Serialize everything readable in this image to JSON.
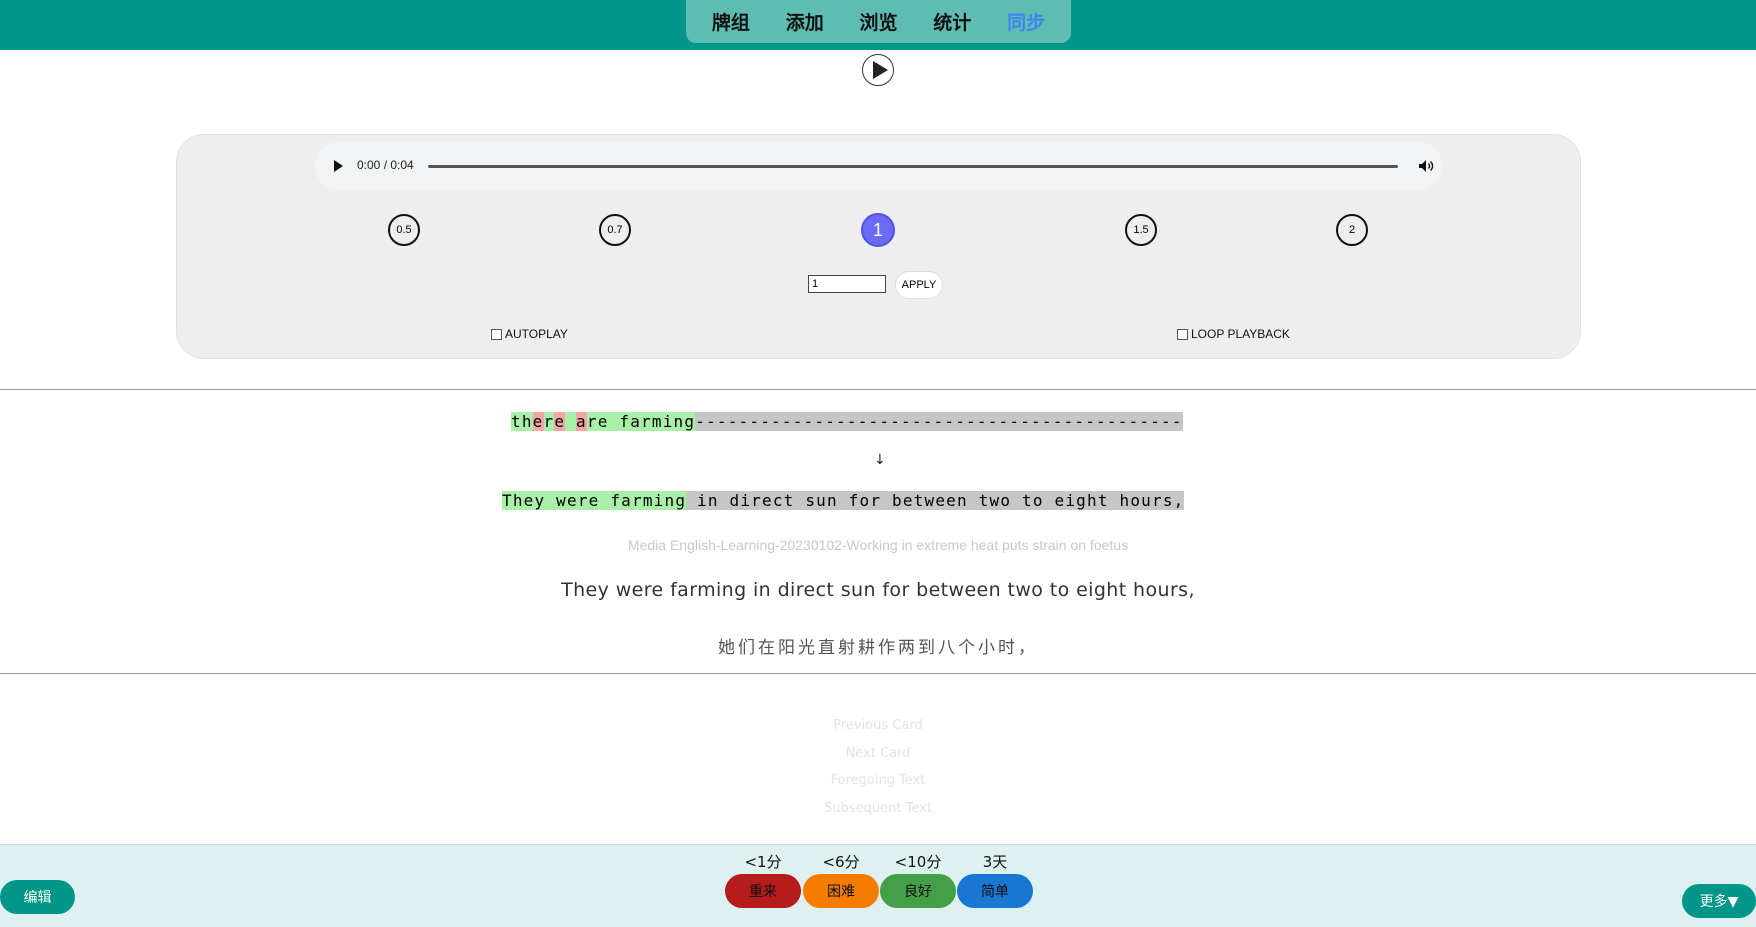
{
  "nav": {
    "items": [
      {
        "label": "牌组"
      },
      {
        "label": "添加"
      },
      {
        "label": "浏览"
      },
      {
        "label": "统计"
      },
      {
        "label": "同步",
        "active": true
      }
    ]
  },
  "player": {
    "time": "0:00 / 0:04",
    "progress": 0,
    "speeds": [
      "0.5",
      "0.7",
      "1",
      "1.5",
      "2"
    ],
    "active_speed": "1",
    "rate_value": "1",
    "apply_label": "APPLY",
    "autoplay_label": "AUTOPLAY",
    "loop_label": "LOOP PLAYBACK"
  },
  "diff": {
    "typed_segments": [
      {
        "text": "th",
        "state": "match"
      },
      {
        "text": "e",
        "state": "wrong"
      },
      {
        "text": "r",
        "state": "match"
      },
      {
        "text": "e",
        "state": "wrong"
      },
      {
        "text": " ",
        "state": "match"
      },
      {
        "text": "a",
        "state": "wrong"
      },
      {
        "text": "re farming",
        "state": "match"
      },
      {
        "text": "---------------------------------------------",
        "state": "missing"
      }
    ],
    "arrow": "↓",
    "reference_segments": [
      {
        "text": "They were farming",
        "state": "match"
      },
      {
        "text": " in direct sun for between two to eight hours,",
        "state": "missing"
      }
    ]
  },
  "card": {
    "source": "Media English-Learning-20230102-Working in extreme heat puts strain on foetus",
    "sentence": "They were farming in direct sun for between two to eight hours,",
    "translation": "她们在阳光直射耕作两到八个小时，"
  },
  "links": [
    "Previous Card",
    "Next Card",
    "Foregoing Text",
    "Subsequent Text"
  ],
  "answers": [
    {
      "interval": "<1分",
      "label": "重来",
      "color": "#b71c1c"
    },
    {
      "interval": "<6分",
      "label": "困难",
      "color": "#f57c00"
    },
    {
      "interval": "<10分",
      "label": "良好",
      "color": "#43a047"
    },
    {
      "interval": "3天",
      "label": "简单",
      "color": "#1976d2"
    }
  ],
  "edit_label": "编辑",
  "more_label": "更多▼",
  "colors": {
    "header": "#009688",
    "nav_active": "#3d86f5",
    "match": "#a8f0a8",
    "wrong": "#f4a5a5",
    "missing": "#c6c6c6"
  }
}
